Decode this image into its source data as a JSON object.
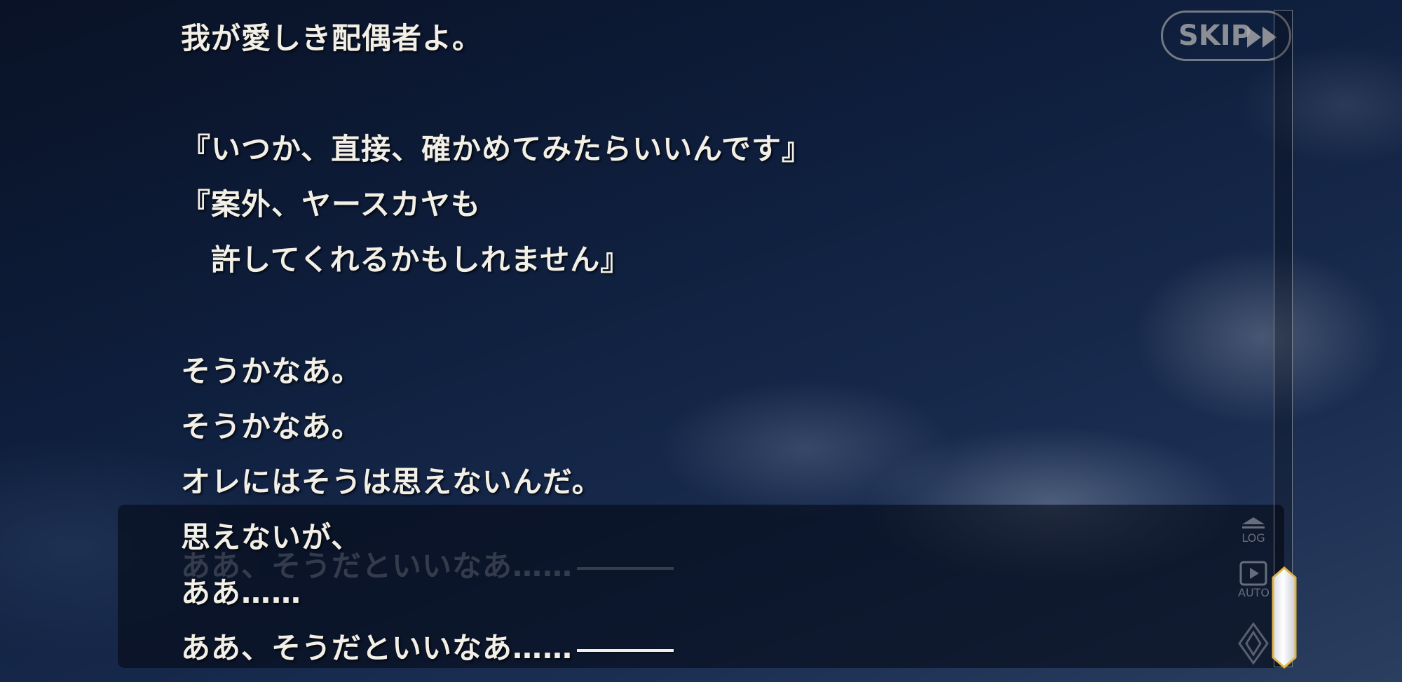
{
  "dialogue": {
    "lines": [
      "我が愛しき配偶者よ。",
      "『いつか、直接、確かめてみたらいいんです』",
      "『案外、ヤースカヤも",
      "　許してくれるかもしれません』",
      "そうかなあ。",
      "そうかなあ。",
      "オレにはそうは思えないんだ。",
      "思えないが、",
      "ああ……",
      "ああ、そうだといいなあ……"
    ],
    "ghost_line": "ああ、そうだといいなあ……"
  },
  "controls": {
    "skip_label": "SKIP",
    "log_label": "LOG",
    "auto_label": "AUTO"
  },
  "icons": [
    "fast-forward-icon",
    "log-up-icon",
    "play-icon",
    "menu-diamond-icon",
    "scroll-thumb-crystal-icon"
  ],
  "colors": {
    "text": "#f2efe6",
    "sky_dark": "#091226",
    "sky_light": "#2b3e5f",
    "message_box": "rgba(5,10,22,0.62)"
  }
}
